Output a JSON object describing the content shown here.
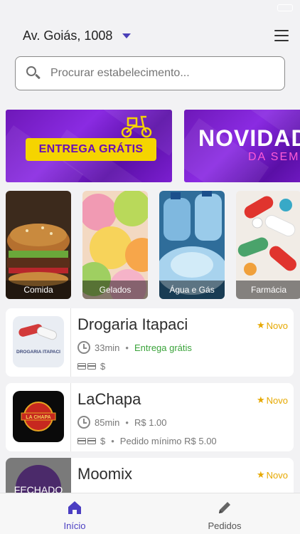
{
  "header": {
    "address": "Av. Goiás, 1008"
  },
  "search": {
    "placeholder": "Procurar estabelecimento..."
  },
  "banners": [
    {
      "text": "ENTREGA GRÁTIS"
    },
    {
      "text": "NOVIDAD",
      "subtext": "DA SEM"
    }
  ],
  "categories": [
    {
      "label": "Comida"
    },
    {
      "label": "Gelados"
    },
    {
      "label": "Água e Gás"
    },
    {
      "label": "Farmácia"
    }
  ],
  "stores": [
    {
      "name": "Drogaria Itapaci",
      "badge": "Novo",
      "time": "33min",
      "delivery": "Entrega grátis",
      "payment": "$",
      "logo_text": "DROGARIA ITAPACI"
    },
    {
      "name": "LaChapa",
      "badge": "Novo",
      "time": "85min",
      "delivery": "R$ 1.00",
      "payment": "$",
      "minimum": "Pedido mínimo R$ 5.00",
      "logo_text": "LA CHAPA"
    },
    {
      "name": "Moomix",
      "badge": "Novo",
      "logo_text": "FECHADO"
    }
  ],
  "tabs": {
    "home": "Início",
    "orders": "Pedidos"
  },
  "colors": {
    "accent": "#4b3ec2",
    "badge": "#e6a800",
    "free_delivery": "#3aa33a",
    "banner_purple": "#7b1fd0",
    "pill_yellow": "#f5d400"
  }
}
